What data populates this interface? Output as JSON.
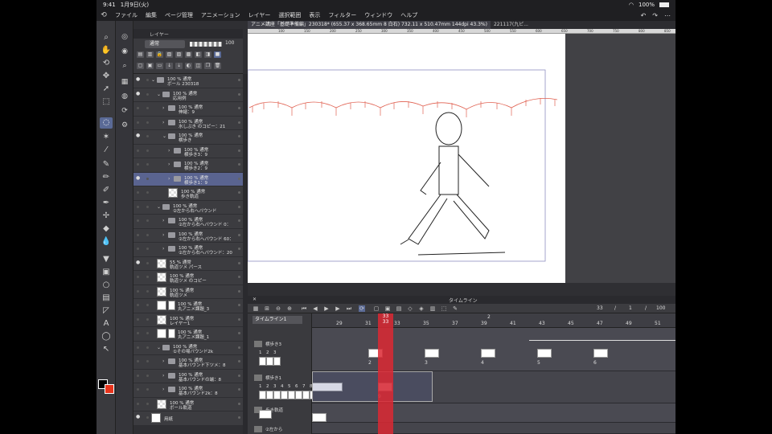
{
  "status": {
    "time": "9:41",
    "date": "1月9日(火)",
    "battery": "100%"
  },
  "menu": [
    "ファイル",
    "編集",
    "ページ管理",
    "アニメーション",
    "レイヤー",
    "選択範囲",
    "表示",
    "フィルター",
    "ウィンドウ",
    "ヘルプ"
  ],
  "tabs": [
    {
      "label": "アニメ講座「基礎準備編」230318* (655.37 x 368.65mm 8 白石) 732.11 x 510.47mm 144dpi 43.3%)",
      "active": true
    },
    {
      "label": "221117(九ピ...",
      "active": false
    }
  ],
  "layer_panel": {
    "title": "レイヤー",
    "blend": "通常",
    "opacity": "100",
    "layers": [
      {
        "pct": "100 % 通常",
        "name": "ボール 230318",
        "type": "folder",
        "indent": 0,
        "eye": true
      },
      {
        "pct": "100 % 通常",
        "name": "応用例",
        "type": "folder",
        "indent": 1,
        "eye": true
      },
      {
        "pct": "100 % 通常",
        "name": "伸縮：9",
        "type": "anim",
        "indent": 2,
        "eye": false
      },
      {
        "pct": "100 % 通常",
        "name": "水しぶき のコピー：21",
        "type": "anim",
        "indent": 2,
        "eye": false
      },
      {
        "pct": "100 % 通常",
        "name": "横歩き",
        "type": "folder",
        "indent": 2,
        "eye": true
      },
      {
        "pct": "100 % 通常",
        "name": "横歩き3：9",
        "type": "anim",
        "indent": 3,
        "eye": false
      },
      {
        "pct": "100 % 通常",
        "name": "横歩き2：9",
        "type": "anim",
        "indent": 3,
        "eye": false
      },
      {
        "pct": "100 % 通常",
        "name": "横歩き1：9",
        "type": "anim",
        "indent": 3,
        "eye": true,
        "selected": true
      },
      {
        "pct": "100 % 通常",
        "name": "歩き軌道",
        "type": "raster",
        "indent": 3,
        "eye": false
      },
      {
        "pct": "100 % 通常",
        "name": "②左から右へバウンド",
        "type": "folder",
        "indent": 1,
        "eye": false
      },
      {
        "pct": "100 % 通常",
        "name": "②左から右へバウンド 0：",
        "type": "anim",
        "indent": 2,
        "eye": false
      },
      {
        "pct": "100 % 通常",
        "name": "②左から右へバウンド 60：",
        "type": "anim",
        "indent": 2,
        "eye": false
      },
      {
        "pct": "100 % 通常",
        "name": "②左から右へバウンド：20",
        "type": "anim",
        "indent": 2,
        "eye": false
      },
      {
        "pct": "55 % 通常",
        "name": "軌道ツメ パース",
        "type": "raster",
        "indent": 1,
        "eye": true
      },
      {
        "pct": "100 % 通常",
        "name": "軌道ツメ のコピー",
        "type": "raster",
        "indent": 1,
        "eye": false
      },
      {
        "pct": "100 % 通常",
        "name": "軌道ツメ",
        "type": "raster",
        "indent": 1,
        "eye": false
      },
      {
        "pct": "100 % 通常",
        "name": "丸アニメ課題_3",
        "type": "raster2",
        "indent": 1,
        "eye": false
      },
      {
        "pct": "100 % 通常",
        "name": "レイヤー1",
        "type": "raster",
        "indent": 1,
        "eye": false
      },
      {
        "pct": "100 % 通常",
        "name": "丸アニメ課題_1",
        "type": "raster2",
        "indent": 1,
        "eye": false
      },
      {
        "pct": "100 % 通常",
        "name": "①その場バウンド2k",
        "type": "folder",
        "indent": 1,
        "eye": false
      },
      {
        "pct": "100 % 通常",
        "name": "基本バウンド下ツメ：8",
        "type": "anim",
        "indent": 2,
        "eye": false
      },
      {
        "pct": "100 % 通常",
        "name": "基本バウンドの端：8",
        "type": "anim",
        "indent": 2,
        "eye": false
      },
      {
        "pct": "100 % 通常",
        "name": "基本バウンド2k：8",
        "type": "anim",
        "indent": 2,
        "eye": false
      },
      {
        "pct": "100 % 通常",
        "name": "ボール軌道",
        "type": "raster",
        "indent": 1,
        "eye": false
      },
      {
        "pct": "",
        "name": "用紙",
        "type": "paper",
        "indent": 0,
        "eye": true
      }
    ]
  },
  "ruler_labels": [
    "100",
    "150",
    "200",
    "250",
    "300",
    "350",
    "400",
    "450",
    "500",
    "550",
    "600",
    "650",
    "700",
    "750",
    "800",
    "850"
  ],
  "timeline": {
    "title": "タイムライン",
    "current": "33",
    "start": "1",
    "mid": "/",
    "end": "100",
    "track_name": "タイムライン1",
    "frame_labels": [
      "29",
      "31",
      "33",
      "35",
      "37",
      "39",
      "41",
      "43",
      "45",
      "47",
      "49",
      "51",
      "53"
    ],
    "top_label": "2",
    "tracks": [
      {
        "name": "横歩き3",
        "nums": [
          "1",
          "2",
          "3"
        ],
        "cel_nums": [
          "2",
          "3",
          "4",
          "5",
          "6"
        ]
      },
      {
        "name": "横歩き1",
        "nums": [
          "1",
          "2",
          "3",
          "4",
          "5",
          "6",
          "7",
          "8",
          "9"
        ],
        "cel_nums": [
          "9"
        ]
      },
      {
        "name": "歩き軌道",
        "nums": [],
        "cel_nums": []
      },
      {
        "name": "②左から",
        "nums": [],
        "cel_nums": []
      }
    ]
  },
  "colors": {
    "main": "#000000",
    "sub": "#e8341c",
    "accent": "#5a6a96",
    "playhead": "#dc2832"
  }
}
